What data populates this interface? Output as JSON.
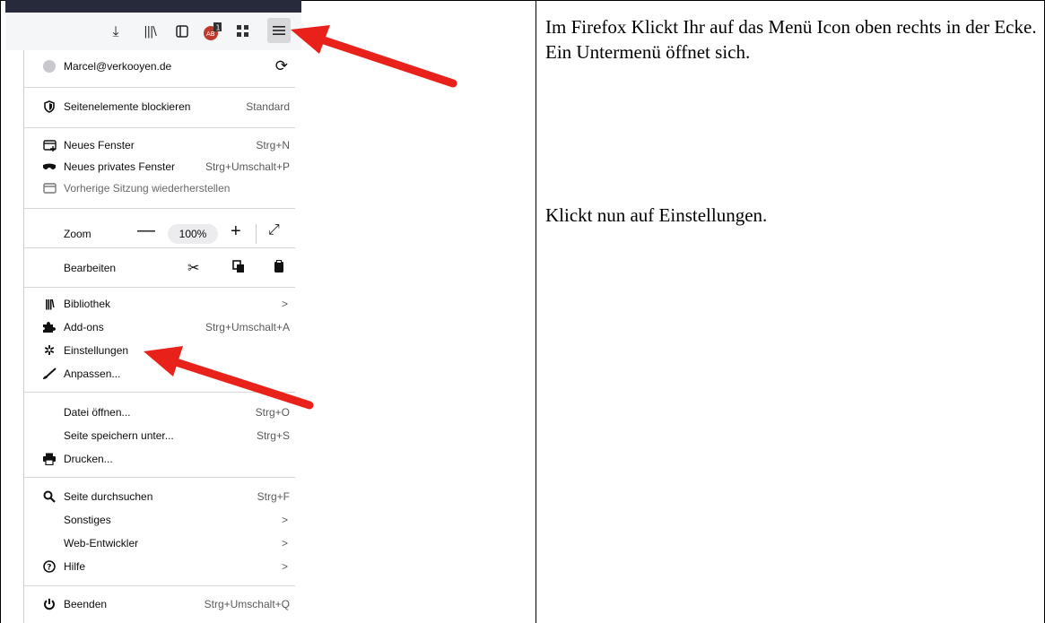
{
  "toolbar": {
    "icons": [
      "download-icon",
      "library-icon",
      "sidebar-icon",
      "adblock-icon",
      "extensions-icon",
      "menu-icon"
    ],
    "adblock_badge": "1"
  },
  "menu": {
    "account": "Marcel@verkooyen.de",
    "blocking": {
      "label": "Seitenelemente blockieren",
      "value": "Standard"
    },
    "new_window": {
      "label": "Neues Fenster",
      "shortcut": "Strg+N"
    },
    "private_window": {
      "label": "Neues privates Fenster",
      "shortcut": "Strg+Umschalt+P"
    },
    "restore_session": {
      "label": "Vorherige Sitzung wiederherstellen"
    },
    "zoom": {
      "label": "Zoom",
      "minus": "—",
      "value": "100%",
      "plus": "+"
    },
    "edit": {
      "label": "Bearbeiten"
    },
    "library": {
      "label": "Bibliothek",
      "chevron": ">"
    },
    "addons": {
      "label": "Add-ons",
      "shortcut": "Strg+Umschalt+A"
    },
    "settings": {
      "label": "Einstellungen"
    },
    "customize": {
      "label": "Anpassen..."
    },
    "open_file": {
      "label": "Datei öffnen...",
      "shortcut": "Strg+O"
    },
    "save_page": {
      "label": "Seite speichern unter...",
      "shortcut": "Strg+S"
    },
    "print": {
      "label": "Drucken..."
    },
    "find": {
      "label": "Seite durchsuchen",
      "shortcut": "Strg+F"
    },
    "more": {
      "label": "Sonstiges",
      "chevron": ">"
    },
    "webdev": {
      "label": "Web-Entwickler",
      "chevron": ">"
    },
    "help": {
      "label": "Hilfe",
      "chevron": ">"
    },
    "quit": {
      "label": "Beenden",
      "shortcut": "Strg+Umschalt+Q"
    }
  },
  "instructions": {
    "step1": "Im Firefox Klickt Ihr auf das Menü Icon oben rechts in der Ecke. Ein Untermenü öffnet sich.",
    "step2": "Klickt nun auf Einstellungen."
  },
  "colors": {
    "arrow": "#e8221b",
    "toolbar_dark": "#262a3b"
  }
}
